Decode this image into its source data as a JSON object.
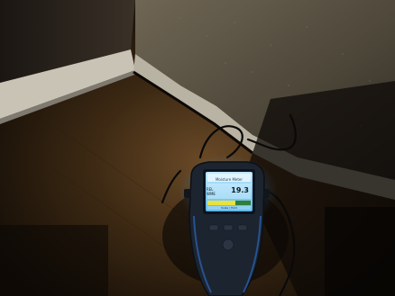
{
  "meter": {
    "header": "Moisture Meter",
    "row_label": "REL WME",
    "reading": "19.3",
    "footer": "Scale / Hold"
  }
}
